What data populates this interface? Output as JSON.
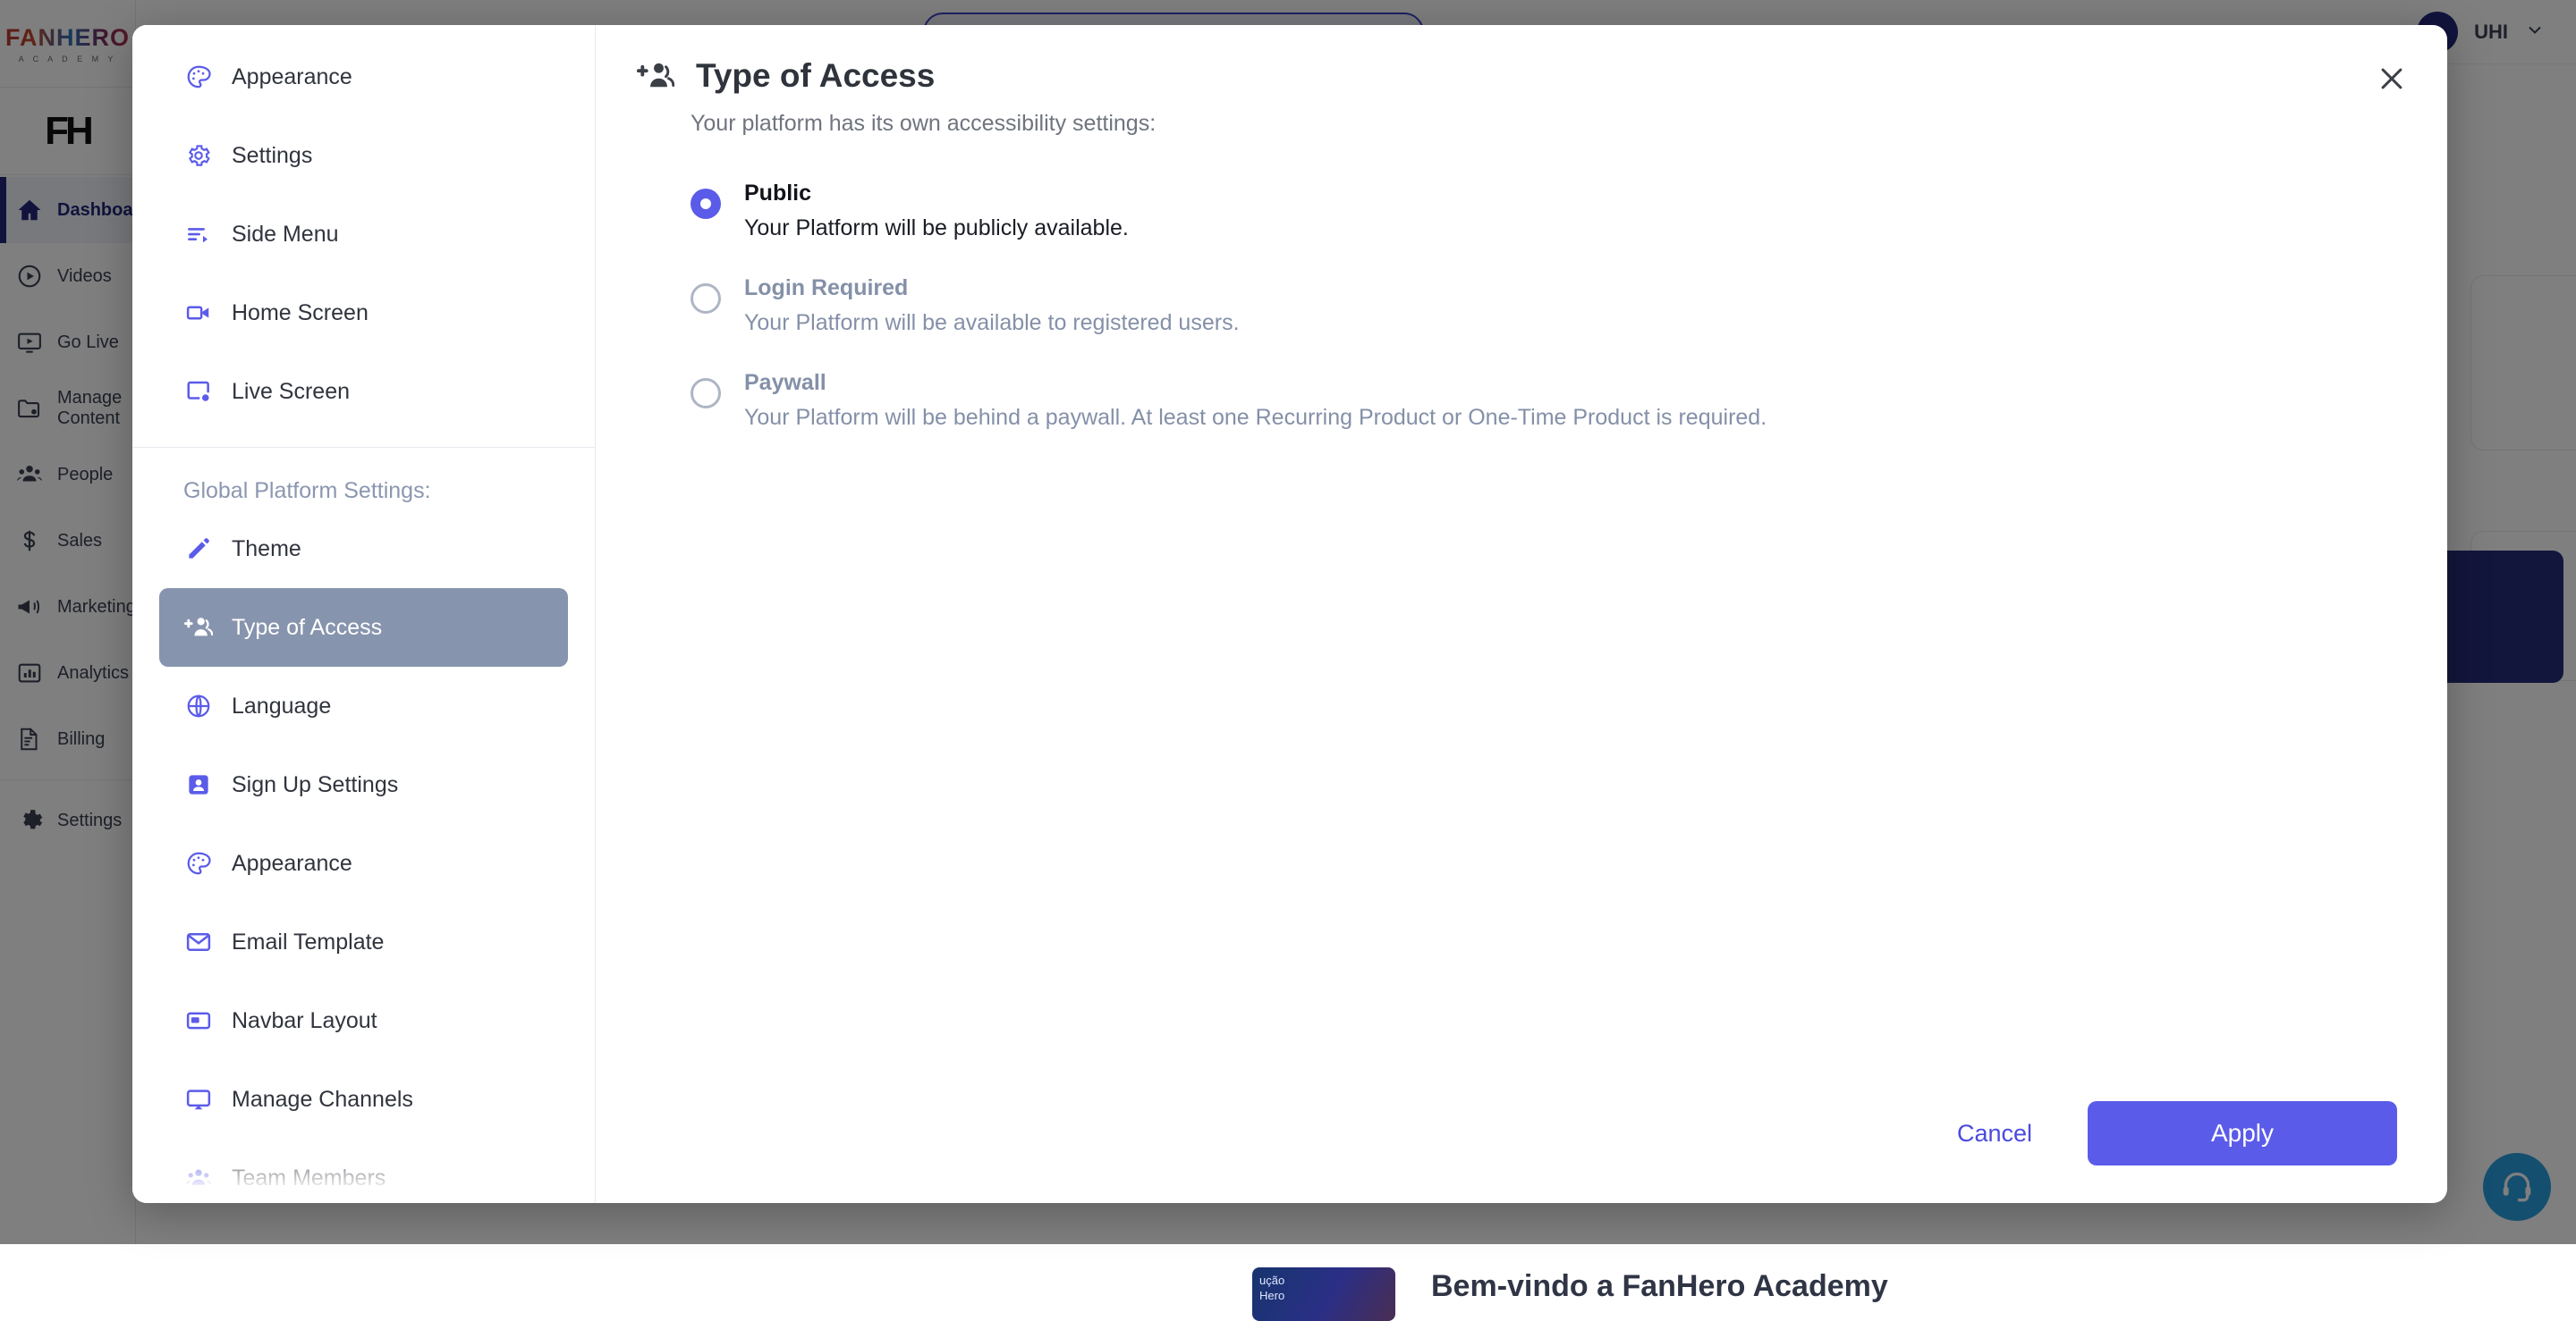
{
  "background": {
    "brand": {
      "word": "FANHERO",
      "sub": "A C A D E M Y",
      "logo_mark": "FH"
    },
    "nav_items": [
      {
        "label": "Dashboard",
        "icon": "home-icon",
        "active": true
      },
      {
        "label": "Videos",
        "icon": "play-circle-icon",
        "active": false
      },
      {
        "label": "Go Live",
        "icon": "live-tv-icon",
        "active": false
      },
      {
        "label": "Manage Content",
        "icon": "folder-settings-icon",
        "active": false
      },
      {
        "label": "People",
        "icon": "people-icon",
        "active": false
      },
      {
        "label": "Sales",
        "icon": "dollar-icon",
        "active": false
      },
      {
        "label": "Marketing",
        "icon": "megaphone-icon",
        "active": false
      },
      {
        "label": "Analytics",
        "icon": "bar-chart-icon",
        "active": false
      },
      {
        "label": "Billing",
        "icon": "invoice-icon",
        "active": false
      },
      {
        "label": "Settings",
        "icon": "gear-icon",
        "active": false
      }
    ],
    "topbar": {
      "user": "UHI",
      "caret": "⌄"
    },
    "hero": {
      "title": "Bem-vindo a FanHero Academy",
      "thumb_line1": "ução",
      "thumb_line2": "Hero"
    },
    "support": {
      "icon": "headset-icon"
    }
  },
  "modal": {
    "close_icon": "close-icon",
    "nav": {
      "top_items": [
        {
          "label": "Appearance",
          "icon": "palette-icon"
        },
        {
          "label": "Settings",
          "icon": "gear-icon"
        },
        {
          "label": "Side Menu",
          "icon": "side-menu-icon"
        },
        {
          "label": "Home Screen",
          "icon": "video-camera-icon"
        },
        {
          "label": "Live Screen",
          "icon": "live-screen-icon"
        }
      ],
      "group_heading": "Global Platform Settings:",
      "group_items": [
        {
          "label": "Theme",
          "icon": "pencil-icon",
          "active": false
        },
        {
          "label": "Type of Access",
          "icon": "add-people-icon",
          "active": true
        },
        {
          "label": "Language",
          "icon": "globe-icon",
          "active": false
        },
        {
          "label": "Sign Up Settings",
          "icon": "user-badge-icon",
          "active": false
        },
        {
          "label": "Appearance",
          "icon": "palette-icon",
          "active": false
        },
        {
          "label": "Email Template",
          "icon": "envelope-icon",
          "active": false
        },
        {
          "label": "Navbar Layout",
          "icon": "navbar-layout-icon",
          "active": false
        },
        {
          "label": "Manage Channels",
          "icon": "manage-channels-icon",
          "active": false
        },
        {
          "label": "Team Members",
          "icon": "team-members-icon",
          "active": false
        }
      ]
    },
    "content": {
      "title": "Type of Access",
      "title_icon": "add-people-icon",
      "subtitle": "Your platform has its own accessibility settings:",
      "options": [
        {
          "label": "Public",
          "description": "Your Platform will be publicly available.",
          "selected": true
        },
        {
          "label": "Login Required",
          "description": "Your Platform will be available to registered users.",
          "selected": false
        },
        {
          "label": "Paywall",
          "description": "Your Platform will be behind a paywall. At least one Recurring Product or One-Time Product is required.",
          "selected": false
        }
      ]
    },
    "footer": {
      "cancel_label": "Cancel",
      "apply_label": "Apply"
    }
  },
  "colors": {
    "accent_purple": "#5b5bea",
    "active_nav_slate": "#8794ad",
    "muted_text": "#8490a8",
    "support_blue": "#2a9fe0",
    "brand_navy": "#22277a"
  }
}
